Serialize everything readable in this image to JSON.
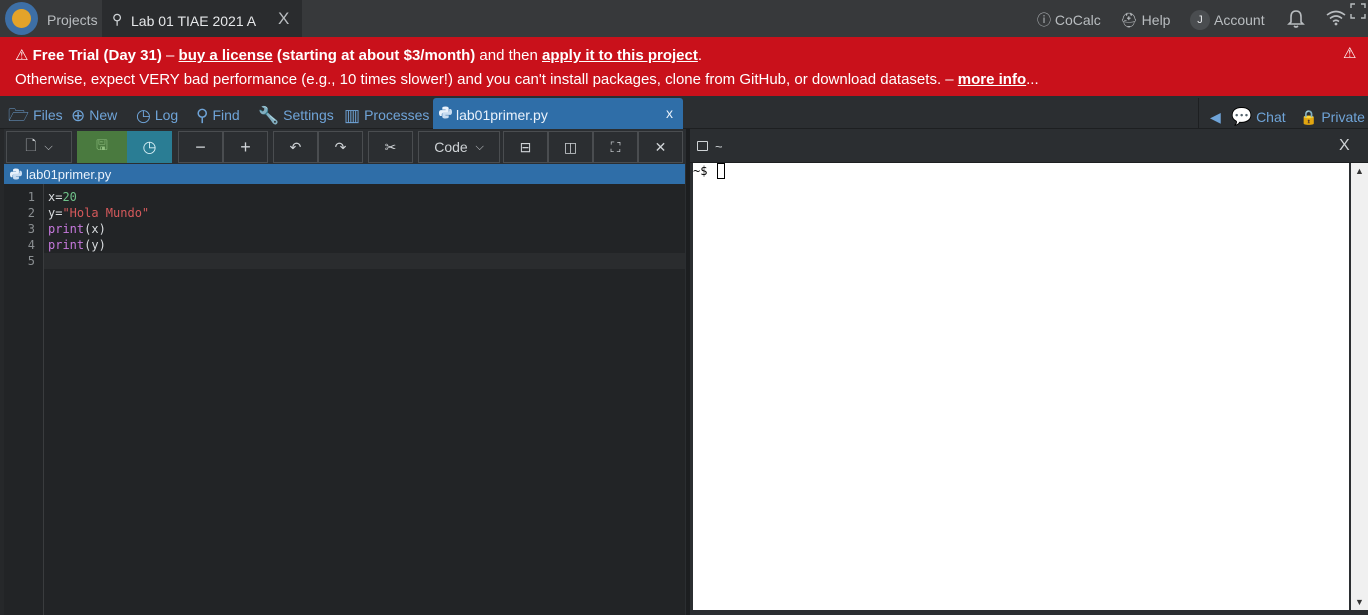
{
  "topbar": {
    "projects_label": "Projects",
    "project_tab": "Lab 01 TIAE 2021 A",
    "project_close": "X",
    "cocalc_label": "CoCalc",
    "help_label": "Help",
    "account_initial": "J",
    "account_label": "Account"
  },
  "banner": {
    "warning_symbol": "⚠",
    "trial_text": "Free Trial (Day 31)",
    "dash1": " – ",
    "buy_link": "buy a license",
    "price_text": " (starting at about $3/month)",
    "and_then": " and then ",
    "apply_link": "apply it to this project",
    "period": ".",
    "line2_text": "Otherwise, expect VERY bad performance (e.g., 10 times slower!) and you can't install packages, clone from GitHub, or download datasets. – ",
    "more_info_link": "more info",
    "ellipsis": "..."
  },
  "project_toolbar": {
    "files": "Files",
    "new": "New",
    "log": "Log",
    "find": "Find",
    "settings": "Settings",
    "processes": "Processes",
    "open_file_tab": "lab01primer.py",
    "open_file_close": "x",
    "chat": "Chat",
    "private": "Private"
  },
  "editor_toolbar": {
    "mode_label": "Code"
  },
  "editor": {
    "filename": "lab01primer.py",
    "line_numbers": [
      "1",
      "2",
      "3",
      "4",
      "5"
    ],
    "lines": {
      "l1_var": "x=",
      "l1_num": "20",
      "l2_var": "y=",
      "l2_str": "\"Hola Mundo\"",
      "l3_kw": "print",
      "l3_rest": "(x)",
      "l4_kw": "print",
      "l4_rest": "(y)"
    }
  },
  "terminal": {
    "title": "~",
    "prompt": "~$ ",
    "close": "X"
  },
  "colors": {
    "banner_bg": "#c9111b",
    "accent_blue": "#2f6ea8",
    "link_blue": "#6fa4d8",
    "save_green": "#4a7a3f",
    "timetravel_teal": "#2a7d94"
  },
  "icons": {
    "topbar": [
      "cocalc-logo-icon",
      "pin-icon",
      "info-icon",
      "help-icon",
      "bell-icon",
      "wifi-icon",
      "fullscreen-icon"
    ],
    "project_toolbar": [
      "folder-open-icon",
      "plus-circle-icon",
      "history-icon",
      "search-icon",
      "wrench-icon",
      "microchip-icon",
      "python-icon",
      "caret-left-icon",
      "chat-icon",
      "lock-icon"
    ],
    "editor_toolbar": [
      "file-icon",
      "caret-down-icon",
      "save-icon",
      "timetravel-icon",
      "zoom-out-icon",
      "zoom-in-icon",
      "undo-icon",
      "redo-icon",
      "scissors-icon",
      "split-horizontal-icon",
      "split-vertical-icon",
      "expand-icon",
      "close-icon"
    ]
  }
}
